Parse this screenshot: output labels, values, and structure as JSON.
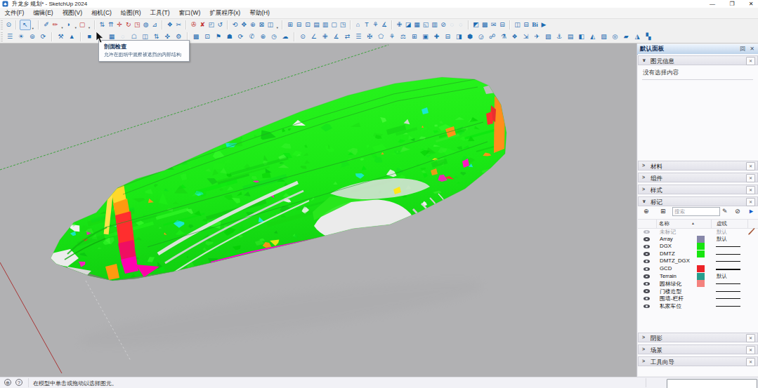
{
  "window": {
    "title": "升龙乡 规划* - SketchUp 2024",
    "controls": {
      "minimize": "—",
      "maximize": "❐",
      "close": "✕"
    }
  },
  "menu": {
    "items": [
      "文件(F)",
      "编辑(E)",
      "视图(V)",
      "相机(C)",
      "绘图(R)",
      "工具(T)",
      "窗口(W)",
      "扩展程序(x)",
      "帮助(H)"
    ]
  },
  "toolbars": {
    "row1": [
      {
        "n": "zoom-select-tool",
        "g": "⊙"
      },
      {
        "t": "sep"
      },
      {
        "n": "select-tool",
        "g": "↖",
        "p": 1,
        "d": 1
      },
      {
        "t": "sep"
      },
      {
        "n": "eraser-tool",
        "g": "✐"
      },
      {
        "n": "line-tool",
        "g": "✏",
        "c": "red",
        "d": 1
      },
      {
        "n": "arc-tool",
        "g": "◗",
        "d": 1
      },
      {
        "n": "rectangle-tool",
        "g": "▢",
        "c": "red",
        "d": 1
      },
      {
        "t": "sep"
      },
      {
        "n": "push-pull-tool",
        "g": "⇅"
      },
      {
        "n": "follow-me-tool",
        "g": "⇈"
      },
      {
        "n": "move-tool",
        "g": "✛",
        "c": "red"
      },
      {
        "n": "rotate-tool",
        "g": "↻",
        "c": "red"
      },
      {
        "n": "scale-tool",
        "g": "◳",
        "c": "red"
      },
      {
        "n": "offset-tool",
        "g": "◍"
      },
      {
        "n": "tape-measure-tool",
        "g": "⊿"
      },
      {
        "t": "sep"
      },
      {
        "n": "paint-bucket-tool",
        "g": "❖"
      },
      {
        "n": "soften-edges-tool",
        "g": "✂"
      },
      {
        "t": "sep"
      },
      {
        "n": "glue-tool",
        "g": "✇",
        "c": "red"
      },
      {
        "n": "unglue-tool",
        "g": "✘",
        "c": "red"
      },
      {
        "n": "zoom-window-tool",
        "g": "◰"
      },
      {
        "n": "previous-view-tool",
        "g": "↺"
      },
      {
        "t": "sep"
      },
      {
        "n": "orbit-tool",
        "g": "⟲"
      },
      {
        "n": "pan-tool",
        "g": "✥"
      },
      {
        "n": "zoom-tool",
        "g": "⊕"
      },
      {
        "n": "zoom-extents-tool",
        "g": "⊠"
      },
      {
        "n": "section-plane-tool",
        "g": "◫",
        "d": 1
      },
      {
        "t": "sep"
      },
      {
        "n": "new-scene-button",
        "g": "⊞"
      },
      {
        "n": "copy-scene-button",
        "g": "⊟"
      },
      {
        "n": "update-scene-button",
        "g": "⊡"
      },
      {
        "n": "page-layout-button",
        "g": "▤"
      },
      {
        "n": "page-grid-button",
        "g": "▥"
      },
      {
        "n": "page-blank-button",
        "g": "▢"
      },
      {
        "n": "page-corner-button",
        "g": "◳"
      },
      {
        "t": "sep"
      },
      {
        "n": "home-button",
        "g": "⌂"
      },
      {
        "n": "text-tool",
        "g": "T"
      },
      {
        "n": "3d-text-tool",
        "g": "⚘"
      },
      {
        "n": "dimension-tool",
        "g": "∡"
      },
      {
        "t": "sep"
      },
      {
        "n": "axes-tool",
        "g": "✙"
      },
      {
        "n": "cube-view-button",
        "g": "◪"
      },
      {
        "n": "grid-button",
        "g": "▦"
      },
      {
        "n": "window-preview-button",
        "g": "◱"
      },
      {
        "n": "chart-button",
        "g": "▥"
      },
      {
        "n": "hide-rest-button",
        "g": "⊘"
      },
      {
        "n": "ghost-mode-button",
        "g": "◌",
        "f": 1
      },
      {
        "n": "ghost-mode-2-button",
        "g": "◌",
        "f": 1
      },
      {
        "t": "sep"
      },
      {
        "n": "match-photo-button",
        "g": "◩"
      },
      {
        "n": "export-image-button",
        "g": "▩"
      },
      {
        "n": "export-model-button",
        "g": "✉"
      },
      {
        "n": "document-button",
        "g": "⊟"
      },
      {
        "t": "sep"
      },
      {
        "n": "component-swap-button",
        "g": "◫"
      },
      {
        "n": "equalize-button",
        "g": "⊟"
      },
      {
        "n": "bim-info-button",
        "g": "Bi",
        "bi": 1
      },
      {
        "n": "play-animation-button",
        "g": "▶"
      }
    ],
    "row2": [
      {
        "n": "layer-list-button",
        "g": "☰"
      },
      {
        "n": "sun-settings-button",
        "g": "☀"
      },
      {
        "n": "geo-location-button",
        "g": "⊚"
      },
      {
        "n": "loop-select-button",
        "g": "⟳"
      },
      {
        "t": "sep"
      },
      {
        "n": "safety-helmet-button",
        "g": "⚒"
      },
      {
        "n": "terrain-button",
        "g": "▲"
      },
      {
        "t": "sep"
      },
      {
        "n": "column-button",
        "g": "■"
      },
      {
        "n": "car-ghost-button",
        "g": "◌",
        "f": 1
      },
      {
        "n": "material-grid-button",
        "g": "▦"
      },
      {
        "n": "section-view-button",
        "g": "◌",
        "f": 1
      },
      {
        "n": "temple-button",
        "g": "☖"
      },
      {
        "n": "frame-button",
        "g": "◫"
      },
      {
        "n": "swap-vertical-button",
        "g": "⇅"
      },
      {
        "n": "pipe-button",
        "g": "✜"
      },
      {
        "n": "gear-button",
        "g": "⚙"
      },
      {
        "t": "sep"
      },
      {
        "n": "dark-grid-button",
        "g": "▩"
      },
      {
        "n": "monitor-button",
        "g": "⊡"
      },
      {
        "n": "flag-button",
        "g": "⚑"
      },
      {
        "n": "chair-button",
        "g": "☗"
      },
      {
        "n": "refresh-button",
        "g": "⟳"
      },
      {
        "n": "phone-button",
        "g": "✆"
      },
      {
        "n": "add-circle-button",
        "g": "⊕"
      },
      {
        "n": "clock-button",
        "g": "◷"
      },
      {
        "n": "cloud-button",
        "g": "☁"
      },
      {
        "t": "sep"
      },
      {
        "n": "magnifier-button",
        "g": "⊙"
      },
      {
        "n": "angle-button",
        "g": "∠"
      },
      {
        "n": "ibeam-button",
        "g": "✙"
      },
      {
        "n": "angle-2-button",
        "g": "∡"
      },
      {
        "n": "swap-horizontal-button",
        "g": "⇄"
      },
      {
        "n": "list-button",
        "g": "☰"
      },
      {
        "n": "lock-button",
        "g": "✠"
      },
      {
        "n": "tent-button",
        "g": "⬠"
      },
      {
        "n": "plant-button",
        "g": "⚘"
      },
      {
        "n": "balance-button",
        "g": "⚖"
      },
      {
        "n": "window-grid-button",
        "g": "⊞"
      },
      {
        "n": "filled-box-button",
        "g": "▣"
      },
      {
        "n": "plus-button",
        "g": "✚"
      },
      {
        "n": "minus-box-button",
        "g": "⊟"
      },
      {
        "n": "half-box-button",
        "g": "◨"
      },
      {
        "n": "hex-button",
        "g": "⬢"
      },
      {
        "n": "quarter-circle-button",
        "g": "◶"
      },
      {
        "n": "link-nodes-button",
        "g": "☍"
      },
      {
        "n": "flask-button",
        "g": "⚗"
      },
      {
        "n": "diamond-button",
        "g": "❖"
      },
      {
        "n": "corner-arrow-button",
        "g": "⇲"
      },
      {
        "n": "plane-button",
        "g": "✈"
      },
      {
        "n": "shade-box-button",
        "g": "▧"
      },
      {
        "n": "anchor-button",
        "g": "⚓"
      },
      {
        "n": "film-button",
        "g": "▤"
      },
      {
        "n": "truck-button",
        "g": "◧"
      },
      {
        "n": "image-export-button",
        "g": "◭"
      },
      {
        "n": "layers-button",
        "g": "▨"
      },
      {
        "n": "target-button",
        "g": "◎"
      },
      {
        "n": "render-button",
        "g": "▰"
      },
      {
        "n": "scene-mountain-button",
        "g": "◮"
      },
      {
        "n": "mosaic-button",
        "g": "▚"
      }
    ]
  },
  "tooltip": {
    "title": "剖面检查",
    "description": "允许在图纸中观察被遮挡的内部结构"
  },
  "tray": {
    "title": "默认面板",
    "pin_icon": "回",
    "close_icon": "✕",
    "sections": [
      {
        "label": "图元信息",
        "state": "expanded"
      },
      {
        "label": "材料",
        "state": "collapsed"
      },
      {
        "label": "组件",
        "state": "collapsed"
      },
      {
        "label": "样式",
        "state": "collapsed"
      },
      {
        "label": "标记",
        "state": "expanded"
      },
      {
        "label": "阴影",
        "state": "collapsed"
      },
      {
        "label": "场景",
        "state": "collapsed"
      },
      {
        "label": "工具向导",
        "state": "collapsed"
      }
    ],
    "entity_info": {
      "empty_text": "没有选择内容"
    },
    "tags": {
      "add_icon": "⊕",
      "folder_icon": "⊞",
      "search_placeholder": "搜索",
      "filter_icon": "✎",
      "purge_icon": "⊘",
      "details_icon": "►",
      "columns": {
        "name": "名称",
        "dashes": "虚线"
      },
      "rows": [
        {
          "name": "未标记",
          "swatch": null,
          "dashes": "默认",
          "muted": true,
          "current": true
        },
        {
          "name": "Array",
          "swatch": "#8787a9",
          "dashes": "默认"
        },
        {
          "name": "DGX",
          "swatch": "#17e50f",
          "dashes": "line"
        },
        {
          "name": "DMTZ",
          "swatch": "#17e50f",
          "dashes": "line"
        },
        {
          "name": "DMTZ_DGX",
          "swatch": null,
          "dashes": "line"
        },
        {
          "name": "GCD",
          "swatch": "#ec2227",
          "dashes": "line-bold"
        },
        {
          "name": "Terrain",
          "swatch": "#279e8d",
          "dashes": "默认"
        },
        {
          "name": "园林绿化",
          "swatch": "#f4827e",
          "dashes": "line"
        },
        {
          "name": "门楼造型",
          "swatch": null,
          "dashes": "line"
        },
        {
          "name": "围墙-栏杆",
          "swatch": null,
          "dashes": "line"
        },
        {
          "name": "私家车位",
          "swatch": null,
          "dashes": "line"
        }
      ]
    }
  },
  "statusbar": {
    "geo_icon": "⊕",
    "help_icon": "?",
    "hint": "在模型中单击或拖动以选择图元。",
    "measurement_value": ""
  },
  "viewport": {
    "bg": "#b1b1b3",
    "axis_green": "#3da23d",
    "axis_red": "#a83434",
    "model_green": "#17e817"
  }
}
